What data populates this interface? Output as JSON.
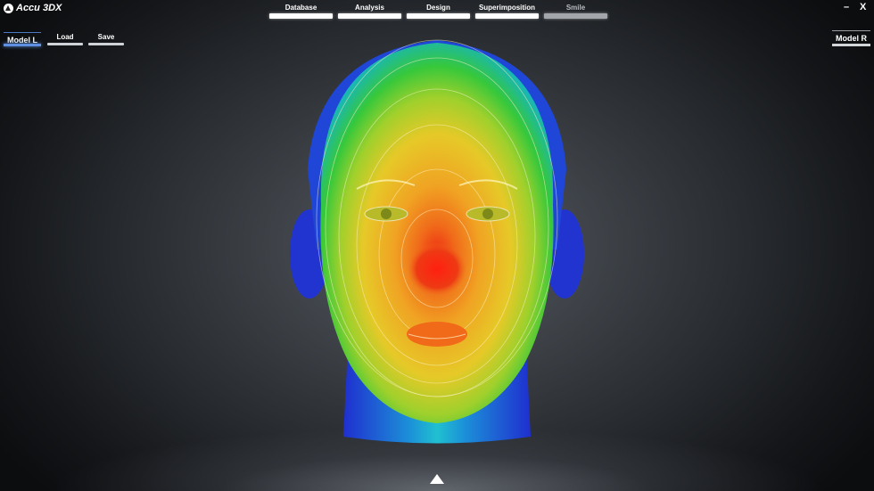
{
  "app": {
    "title": "Accu 3DX",
    "logo_icon": "accu-logo-icon"
  },
  "window_controls": {
    "minimize": "–",
    "close": "X"
  },
  "nav": {
    "tabs": [
      {
        "label": "Database",
        "enabled": true
      },
      {
        "label": "Analysis",
        "enabled": true
      },
      {
        "label": "Design",
        "enabled": true
      },
      {
        "label": "Superimposition",
        "enabled": true
      },
      {
        "label": "Smile",
        "enabled": false
      }
    ]
  },
  "toolbar": {
    "model_l": "Model L",
    "load": "Load",
    "save": "Save",
    "model_r": "Model R",
    "model_l_active": true
  },
  "viewport": {
    "model": "3D head heatmap",
    "colormap": [
      "#1a2fd6",
      "#18b6d8",
      "#35c83a",
      "#e8d825",
      "#f08a1c",
      "#ee2a12"
    ]
  },
  "colors": {
    "accent": "#5f8fe0",
    "tab_bar": "#ffffff",
    "tab_disabled": "#a3a6aa"
  },
  "panel_toggle_icon": "triangle-up-icon"
}
